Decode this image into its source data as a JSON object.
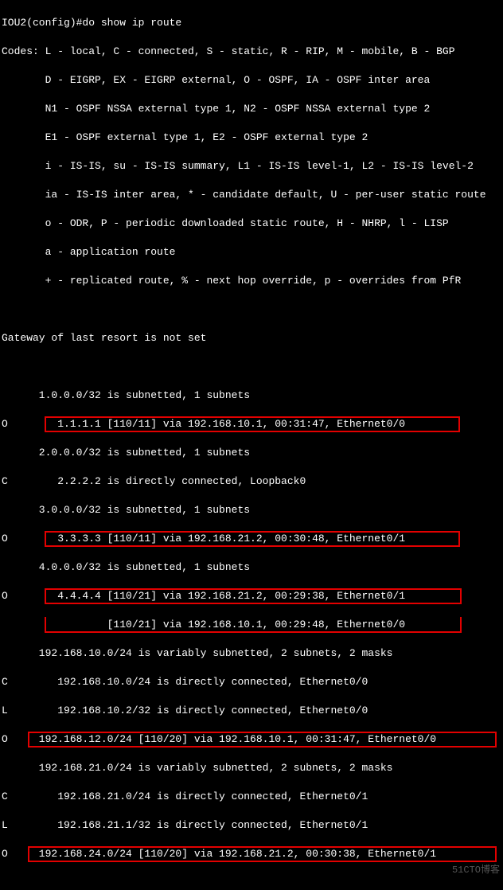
{
  "cmd": "IOU2(config)#do show ip route",
  "codes": [
    "Codes: L - local, C - connected, S - static, R - RIP, M - mobile, B - BGP",
    "       D - EIGRP, EX - EIGRP external, O - OSPF, IA - OSPF inter area",
    "       N1 - OSPF NSSA external type 1, N2 - OSPF NSSA external type 2",
    "       E1 - OSPF external type 1, E2 - OSPF external type 2",
    "       i - IS-IS, su - IS-IS summary, L1 - IS-IS level-1, L2 - IS-IS level-2",
    "       ia - IS-IS inter area, * - candidate default, U - per-user static route",
    "       o - ODR, P - periodic downloaded static route, H - NHRP, l - LISP",
    "       a - application route",
    "       + - replicated route, % - next hop override, p - overrides from PfR"
  ],
  "gateway": "Gateway of last resort is not set",
  "routes": [
    "      1.0.0.0/32 is subnetted, 1 subnets",
    "O        1.1.1.1 [110/11] via 192.168.10.1, 00:31:47, Ethernet0/0",
    "      2.0.0.0/32 is subnetted, 1 subnets",
    "C        2.2.2.2 is directly connected, Loopback0",
    "      3.0.0.0/32 is subnetted, 1 subnets",
    "O        3.3.3.3 [110/11] via 192.168.21.2, 00:30:48, Ethernet0/1",
    "      4.0.0.0/32 is subnetted, 1 subnets",
    "O        4.4.4.4 [110/21] via 192.168.21.2, 00:29:38, Ethernet0/1",
    "                 [110/21] via 192.168.10.1, 00:29:48, Ethernet0/0",
    "      192.168.10.0/24 is variably subnetted, 2 subnets, 2 masks",
    "C        192.168.10.0/24 is directly connected, Ethernet0/0",
    "L        192.168.10.2/32 is directly connected, Ethernet0/0",
    "O     192.168.12.0/24 [110/20] via 192.168.10.1, 00:31:47, Ethernet0/0",
    "      192.168.21.0/24 is variably subnetted, 2 subnets, 2 masks",
    "C        192.168.21.0/24 is directly connected, Ethernet0/1",
    "L        192.168.21.1/32 is directly connected, Ethernet0/1",
    "O     192.168.24.0/24 [110/20] via 192.168.21.2, 00:30:38, Ethernet0/1"
  ],
  "watermark": "51CTO博客"
}
